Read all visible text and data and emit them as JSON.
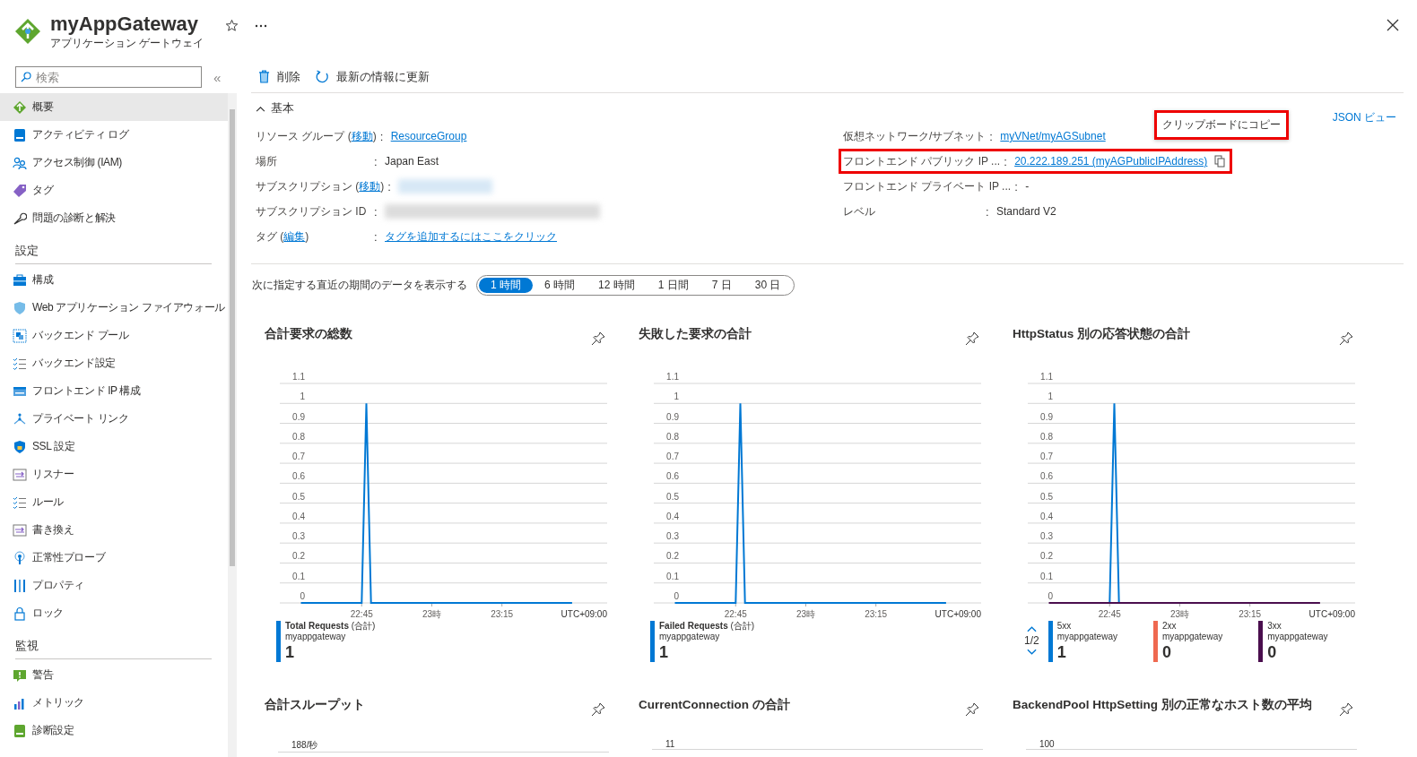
{
  "header": {
    "title": "myAppGateway",
    "subtitle": "アプリケーション ゲートウェイ"
  },
  "sidebar": {
    "search": {
      "placeholder": "検索"
    },
    "collapse": "«",
    "groups": [
      {
        "items": [
          {
            "label": "概要",
            "selected": true
          },
          {
            "label": "アクティビティ ログ",
            "selected": false
          },
          {
            "label": "アクセス制御 (IAM)",
            "selected": false
          },
          {
            "label": "タグ",
            "selected": false
          },
          {
            "label": "問題の診断と解決",
            "selected": false
          }
        ]
      },
      {
        "heading": "設定",
        "items": [
          {
            "label": "構成",
            "selected": false
          },
          {
            "label": "Web アプリケーション ファイアウォール",
            "selected": false
          },
          {
            "label": "バックエンド プール",
            "selected": false
          },
          {
            "label": "バックエンド設定",
            "selected": false
          },
          {
            "label": "フロントエンド IP 構成",
            "selected": false
          },
          {
            "label": "プライベート リンク",
            "selected": false
          },
          {
            "label": "SSL 設定",
            "selected": false
          },
          {
            "label": "リスナー",
            "selected": false
          },
          {
            "label": "ルール",
            "selected": false
          },
          {
            "label": "書き換え",
            "selected": false
          },
          {
            "label": "正常性プローブ",
            "selected": false
          },
          {
            "label": "プロパティ",
            "selected": false
          },
          {
            "label": "ロック",
            "selected": false
          }
        ]
      },
      {
        "heading": "監視",
        "items": [
          {
            "label": "警告",
            "selected": false
          },
          {
            "label": "メトリック",
            "selected": false
          },
          {
            "label": "診断設定",
            "selected": false
          }
        ]
      }
    ]
  },
  "toolbar": [
    {
      "kind": "delete",
      "label": "削除"
    },
    {
      "kind": "refresh",
      "label": "最新の情報に更新"
    }
  ],
  "essentials": {
    "title": "基本",
    "expanded": true,
    "json_view": "JSON ビュー",
    "left": [
      {
        "label": "リソース グループ (",
        "action": "移動",
        "label_end": ")",
        "sep": ":",
        "kind": "link",
        "value": "ResourceGroup"
      },
      {
        "label": "場所",
        "sep": ":",
        "kind": "text",
        "value": "Japan East"
      },
      {
        "label": "サブスクリプション (",
        "action": "移動",
        "label_end": ")",
        "sep": ":",
        "kind": "redacted-link"
      },
      {
        "label": "サブスクリプション ID",
        "sep": ":",
        "kind": "redacted"
      },
      {
        "label": "タグ (",
        "action": "編集",
        "label_end": ")",
        "sep": ":",
        "kind": "link",
        "value": "タグを追加するにはここをクリック"
      }
    ],
    "right": [
      {
        "label": "仮想ネットワーク/サブネット",
        "sep": ":",
        "kind": "link",
        "value": "myVNet/myAGSubnet"
      },
      {
        "label": "フロントエンド パブリック IP ...",
        "sep": ":",
        "kind": "link",
        "value": "20.222.189.251 (myAGPublicIPAddress)",
        "copyable": true,
        "highlighted": true
      },
      {
        "label": "フロントエンド プライベート IP ...",
        "sep": ":",
        "kind": "text",
        "value": "-"
      },
      {
        "label": "レベル",
        "sep": ":",
        "kind": "text",
        "value": "Standard V2"
      }
    ]
  },
  "tooltip": {
    "text": "クリップボードにコピー",
    "highlighted": true
  },
  "time_range": {
    "label": "次に指定する直近の期間のデータを表示する",
    "options": [
      {
        "label": "1 時間",
        "selected": true
      },
      {
        "label": "6 時間",
        "selected": false
      },
      {
        "label": "12 時間",
        "selected": false
      },
      {
        "label": "1 日間",
        "selected": false
      },
      {
        "label": "7 日",
        "selected": false
      },
      {
        "label": "30 日",
        "selected": false
      }
    ]
  },
  "charts": [
    {
      "title": "合計要求の総数",
      "timezone": "UTC+09:00",
      "legend": [
        {
          "resource": "myappgateway",
          "value": "1"
        }
      ],
      "chart_data": {
        "type": "line",
        "grid": true,
        "ylim": [
          0,
          1.1
        ],
        "yticks": [
          0,
          0.1,
          0.2,
          0.3,
          0.4,
          0.5,
          0.6,
          0.7,
          0.8,
          0.9,
          1,
          1.1
        ],
        "categories": [
          null,
          null,
          null,
          null,
          null,
          null,
          null,
          null,
          null,
          null,
          null,
          null,
          null,
          null,
          null,
          null,
          null,
          "22:45",
          null,
          null,
          null,
          null,
          null,
          null,
          null,
          null,
          null,
          null,
          null,
          null,
          null,
          null,
          "23時",
          null,
          null,
          null,
          null,
          null,
          null,
          null,
          null,
          null,
          null,
          null,
          null,
          null,
          null,
          "23:15",
          null,
          null,
          null,
          null,
          null,
          null,
          null,
          null,
          null,
          null,
          null,
          null,
          null,
          null,
          null,
          null,
          null,
          null,
          null,
          null,
          null,
          null
        ],
        "series": [
          {
            "name": "**Total Requests** (合計)",
            "color": "#0078d4",
            "values": [
              null,
              null,
              null,
              null,
              0,
              0,
              0,
              0,
              0,
              0,
              0,
              0,
              0,
              0,
              0,
              0,
              0,
              0,
              1,
              0,
              0,
              0,
              0,
              0,
              0,
              0,
              0,
              0,
              0,
              0,
              0,
              0,
              0,
              0,
              0,
              0,
              0,
              0,
              0,
              0,
              0,
              0,
              0,
              0,
              0,
              0,
              0,
              0,
              0,
              0,
              0,
              0,
              0,
              0,
              0,
              0,
              0,
              0,
              0,
              0,
              0,
              0,
              0,
              null,
              null,
              null,
              null,
              null,
              null,
              null
            ]
          }
        ]
      }
    },
    {
      "title": "失敗した要求の合計",
      "timezone": "UTC+09:00",
      "legend": [
        {
          "resource": "myappgateway",
          "value": "1"
        }
      ],
      "chart_data": {
        "type": "line",
        "grid": true,
        "ylim": [
          0,
          1.1
        ],
        "yticks": [
          0,
          0.1,
          0.2,
          0.3,
          0.4,
          0.5,
          0.6,
          0.7,
          0.8,
          0.9,
          1,
          1.1
        ],
        "categories": [
          null,
          null,
          null,
          null,
          null,
          null,
          null,
          null,
          null,
          null,
          null,
          null,
          null,
          null,
          null,
          null,
          null,
          "22:45",
          null,
          null,
          null,
          null,
          null,
          null,
          null,
          null,
          null,
          null,
          null,
          null,
          null,
          null,
          "23時",
          null,
          null,
          null,
          null,
          null,
          null,
          null,
          null,
          null,
          null,
          null,
          null,
          null,
          null,
          "23:15",
          null,
          null,
          null,
          null,
          null,
          null,
          null,
          null,
          null,
          null,
          null,
          null,
          null,
          null,
          null,
          null,
          null,
          null,
          null,
          null,
          null,
          null
        ],
        "series": [
          {
            "name": "**Failed Requests** (合計)",
            "color": "#0078d4",
            "values": [
              null,
              null,
              null,
              null,
              0,
              0,
              0,
              0,
              0,
              0,
              0,
              0,
              0,
              0,
              0,
              0,
              0,
              0,
              1,
              0,
              0,
              0,
              0,
              0,
              0,
              0,
              0,
              0,
              0,
              0,
              0,
              0,
              0,
              0,
              0,
              0,
              0,
              0,
              0,
              0,
              0,
              0,
              0,
              0,
              0,
              0,
              0,
              0,
              0,
              0,
              0,
              0,
              0,
              0,
              0,
              0,
              0,
              0,
              0,
              0,
              0,
              0,
              0,
              null,
              null,
              null,
              null,
              null,
              null,
              null
            ]
          }
        ]
      }
    },
    {
      "title": "HttpStatus 別の応答状態の合計",
      "timezone": "UTC+09:00",
      "pager": "1/2",
      "legend": [
        {
          "resource": "myappgateway",
          "value": "1"
        },
        {
          "resource": "myappgateway",
          "value": "0"
        },
        {
          "resource": "myappgateway",
          "value": "0"
        }
      ],
      "chart_data": {
        "type": "line",
        "grid": true,
        "ylim": [
          0,
          1.1
        ],
        "yticks": [
          0,
          0.1,
          0.2,
          0.3,
          0.4,
          0.5,
          0.6,
          0.7,
          0.8,
          0.9,
          1,
          1.1
        ],
        "categories": [
          null,
          null,
          null,
          null,
          null,
          null,
          null,
          null,
          null,
          null,
          null,
          null,
          null,
          null,
          null,
          null,
          null,
          "22:45",
          null,
          null,
          null,
          null,
          null,
          null,
          null,
          null,
          null,
          null,
          null,
          null,
          null,
          null,
          "23時",
          null,
          null,
          null,
          null,
          null,
          null,
          null,
          null,
          null,
          null,
          null,
          null,
          null,
          null,
          "23:15",
          null,
          null,
          null,
          null,
          null,
          null,
          null,
          null,
          null,
          null,
          null,
          null,
          null,
          null,
          null,
          null,
          null,
          null,
          null,
          null,
          null,
          null
        ],
        "series": [
          {
            "name": "5xx",
            "color": "#0078d4",
            "values": [
              null,
              null,
              null,
              null,
              null,
              null,
              null,
              null,
              null,
              null,
              null,
              null,
              null,
              null,
              null,
              null,
              null,
              0,
              1,
              0,
              null,
              null,
              null,
              null,
              null,
              null,
              null,
              null,
              null,
              null,
              null,
              null,
              null,
              null,
              null,
              null,
              null,
              null,
              null,
              null,
              null,
              null,
              null,
              null,
              null,
              null,
              null,
              null,
              null,
              null,
              null,
              null,
              null,
              null,
              null,
              null,
              null,
              null,
              null,
              null,
              null,
              null,
              null,
              null,
              null,
              null,
              null,
              null,
              null,
              null
            ]
          },
          {
            "name": "2xx",
            "color": "#ef6950",
            "values": [
              null,
              null,
              null,
              null,
              null,
              null,
              null,
              null,
              null,
              null,
              null,
              null,
              null,
              null,
              null,
              null,
              null,
              null,
              null,
              null,
              null,
              null,
              null,
              null,
              null,
              null,
              null,
              null,
              null,
              null,
              null,
              null,
              null,
              null,
              null,
              null,
              null,
              null,
              null,
              null,
              null,
              null,
              null,
              null,
              null,
              null,
              null,
              null,
              null,
              null,
              null,
              null,
              null,
              null,
              null,
              null,
              null,
              null,
              null,
              null,
              null,
              null,
              null,
              null,
              null,
              null,
              null,
              null,
              null,
              null
            ]
          },
          {
            "name": "3xx",
            "color": "#4a0e4e",
            "values": [
              null,
              null,
              null,
              null,
              0,
              0,
              0,
              0,
              0,
              0,
              0,
              0,
              0,
              0,
              0,
              0,
              0,
              0,
              0,
              0,
              0,
              0,
              0,
              0,
              0,
              0,
              0,
              0,
              0,
              0,
              0,
              0,
              0,
              0,
              0,
              0,
              0,
              0,
              0,
              0,
              0,
              0,
              0,
              0,
              0,
              0,
              0,
              0,
              0,
              0,
              0,
              0,
              0,
              0,
              0,
              0,
              0,
              0,
              0,
              0,
              0,
              0,
              0,
              null,
              null,
              null,
              null,
              null,
              null,
              null
            ]
          }
        ]
      }
    }
  ],
  "more_charts": [
    {
      "title": "合計スループット",
      "top_tick": "188/秒"
    },
    {
      "title": "CurrentConnection の合計",
      "top_tick": "11"
    },
    {
      "title": "BackendPool HttpSetting 別の正常なホスト数の平均",
      "top_tick": "100"
    }
  ]
}
